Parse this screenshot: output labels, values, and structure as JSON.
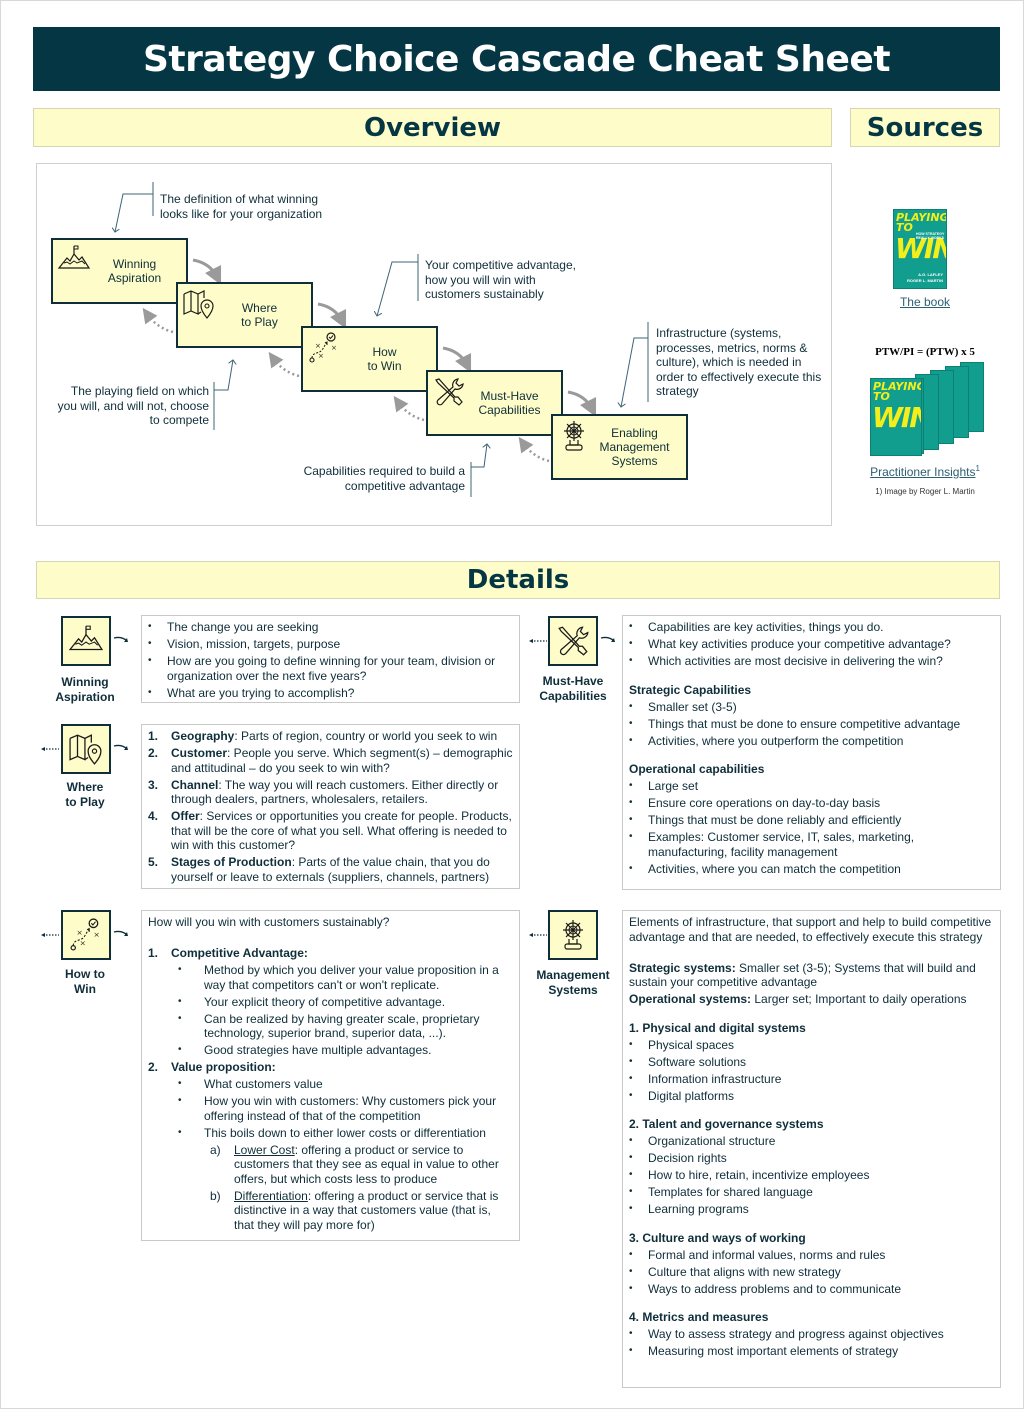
{
  "title": "Strategy Choice Cascade Cheat Sheet",
  "headers": {
    "overview": "Overview",
    "sources": "Sources",
    "details": "Details"
  },
  "colors": {
    "title_bg": "#043644",
    "header_bg": "#fefcc8",
    "box_fill": "#fefcc8",
    "text": "#0f2e3a",
    "book_teal": "#129e8f",
    "book_yellow": "#f4ef1a"
  },
  "overview": {
    "boxes": [
      {
        "label": "Winning\nAspiration",
        "icon": "mountain-flag-icon"
      },
      {
        "label": "Where\nto Play",
        "icon": "map-pin-icon"
      },
      {
        "label": "How\nto Win",
        "icon": "play-diagram-icon"
      },
      {
        "label": "Must-Have\nCapabilities",
        "icon": "tools-icon"
      },
      {
        "label": "Enabling\nManagement\nSystems",
        "icon": "ship-wheel-icon"
      }
    ],
    "annotations": {
      "winning": "The definition of what winning looks like for your organization",
      "where": "The playing field on which you will, and will not, choose to compete",
      "how": "Your competitive advantage, how you will win with customers sustainably",
      "capabilities": "Capabilities required to build a competitive advantage",
      "systems": "Infrastructure (systems, processes, metrics, norms & culture), which is needed in order to effectively execute this strategy"
    }
  },
  "sources": {
    "book_title_lines": [
      "PLAYING",
      "TO",
      "WIN"
    ],
    "book_subtitle": "HOW STRATEGY REALLY WORKS",
    "book_authors": [
      "A.G. LAFLEY",
      "ROGER L. MARTIN"
    ],
    "book_link": "The book",
    "equation": "PTW/PI = (PTW) x 5",
    "insights_link": "Practitioner Insights",
    "insights_sup": "1",
    "footnote": "1) Image by Roger L. Martin"
  },
  "details": {
    "winning": {
      "label": "Winning\nAspiration",
      "items": [
        "The change you are seeking",
        "Vision, mission, targets, purpose",
        "How are you going to define winning for your team, division or organization over the next five years?",
        "What are you trying to accomplish?"
      ]
    },
    "where": {
      "label": "Where\nto Play",
      "items": [
        {
          "num": "1.",
          "term": "Geography",
          "text": ": Parts of region, country or world you seek to win"
        },
        {
          "num": "2.",
          "term": "Customer",
          "text": ": People you serve. Which segment(s) – demographic and attitudinal – do you seek to win with?"
        },
        {
          "num": "3.",
          "term": "Channel",
          "text": ":  The way you will reach customers. Either directly or through dealers, partners, wholesalers, retailers."
        },
        {
          "num": "4.",
          "term": "Offer",
          "text": ": Services or opportunities you create for people. Products, that will be the core of what you sell. What offering is needed to win with this customer?"
        },
        {
          "num": "5.",
          "term": "Stages of Production",
          "text": ": Parts of the value chain, that you do yourself or leave to externals (suppliers, channels, partners)"
        }
      ]
    },
    "how": {
      "label": "How to\nWin",
      "intro": "How will you win with customers sustainably?",
      "sections": [
        {
          "num": "1.",
          "heading": "Competitive Advantage:",
          "items": [
            "Method by which you deliver your value proposition in a way that competitors can't or won't replicate.",
            "Your explicit theory of competitive advantage.",
            "Can be realized by having greater scale, proprietary technology, superior brand, superior data, ...).",
            "Good strategies have multiple advantages."
          ]
        },
        {
          "num": "2.",
          "heading": "Value proposition:",
          "items": [
            "What customers value",
            "How you win with customers: Why customers pick your offering instead of that of the competition",
            "This boils down to either lower costs or differentiation"
          ],
          "options": [
            {
              "num": "a)",
              "term": "Lower Cost",
              "text": ": offering a product or service to customers that they see as equal in value to other offers, but which costs less to produce"
            },
            {
              "num": "b)",
              "term": "Differentiation",
              "text": ": offering a product or service that is distinctive in a way that customers value (that is, that they will pay more for)"
            }
          ]
        }
      ]
    },
    "capabilities": {
      "label": "Must-Have\nCapabilities",
      "intro_items": [
        "Capabilities are key activities, things you do.",
        "What key activities produce your competitive advantage?",
        "Which activities are most decisive in delivering the win?"
      ],
      "strategic_heading": "Strategic Capabilities",
      "strategic_items": [
        "Smaller set (3-5)",
        "Things that must be done to ensure competitive advantage",
        "Activities, where you outperform the competition"
      ],
      "operational_heading": "Operational capabilities",
      "operational_items": [
        "Large set",
        "Ensure core operations on day-to-day basis",
        "Things that must be done reliably and efficiently",
        "Examples: Customer service, IT, sales, marketing, manufacturing, facility management",
        "Activities, where you can match the competition"
      ]
    },
    "systems": {
      "label": "Management\nSystems",
      "intro": "Elements of infrastructure, that support and help to build competitive advantage and that are needed, to effectively execute this strategy",
      "strategic_term": "Strategic systems:",
      "strategic_text": " Smaller set (3-5); Systems that will build and sustain your competitive advantage",
      "operational_term": "Operational systems:",
      "operational_text": " Larger set; Important to daily operations",
      "groups": [
        {
          "heading": "1. Physical and digital systems",
          "items": [
            "Physical spaces",
            "Software solutions",
            "Information infrastructure",
            "Digital platforms"
          ]
        },
        {
          "heading": "2. Talent and governance systems",
          "items": [
            "Organizational structure",
            "Decision rights",
            "How to hire, retain, incentivize employees",
            "Templates for shared language",
            "Learning programs"
          ]
        },
        {
          "heading": "3. Culture and ways of working",
          "items": [
            "Formal and informal values, norms and rules",
            "Culture that aligns with new strategy",
            "Ways to address problems and to communicate"
          ]
        },
        {
          "heading": "4. Metrics and measures",
          "items": [
            "Way to assess strategy and progress against objectives",
            "Measuring most important elements of strategy"
          ]
        }
      ]
    }
  }
}
